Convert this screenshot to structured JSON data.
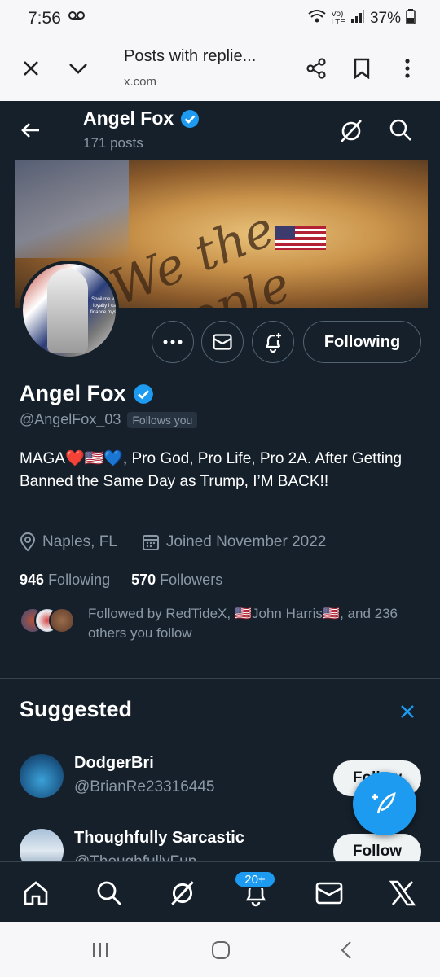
{
  "status": {
    "time": "7:56",
    "battery": "37%"
  },
  "browser": {
    "title": "Posts with replie...",
    "domain": "x.com"
  },
  "profile_header": {
    "name": "Angel Fox",
    "posts": "171 posts"
  },
  "profile": {
    "name": "Angel Fox",
    "handle": "@AngelFox_03",
    "follows_you": "Follows you",
    "avatar_note": "Spoil me with loyalty I can finance myself",
    "bio": "MAGA❤️🇺🇸💙, Pro God, Pro Life, Pro 2A. After Getting Banned the Same Day as Trump, I’M BACK!!",
    "location": "Naples, FL",
    "joined": "Joined November 2022",
    "following_count": "946",
    "following_label": "Following",
    "followers_count": "570",
    "followers_label": "Followers",
    "followed_by": "Followed by RedTideX, 🇺🇸John Harris🇺🇸, and 236 others you follow",
    "following_button": "Following"
  },
  "suggested": {
    "title": "Suggested",
    "items": [
      {
        "name": "DodgerBri",
        "handle": "@BrianRe23316445",
        "button": "Follow"
      },
      {
        "name": "Thoughfully Sarcastic",
        "handle": "@ThoughfullyFun",
        "button": "Follow"
      }
    ]
  },
  "bottom_nav": {
    "badge": "20+"
  },
  "colors": {
    "accent": "#1d9bf0",
    "bg": "#15202b",
    "muted": "#8b98a5"
  }
}
